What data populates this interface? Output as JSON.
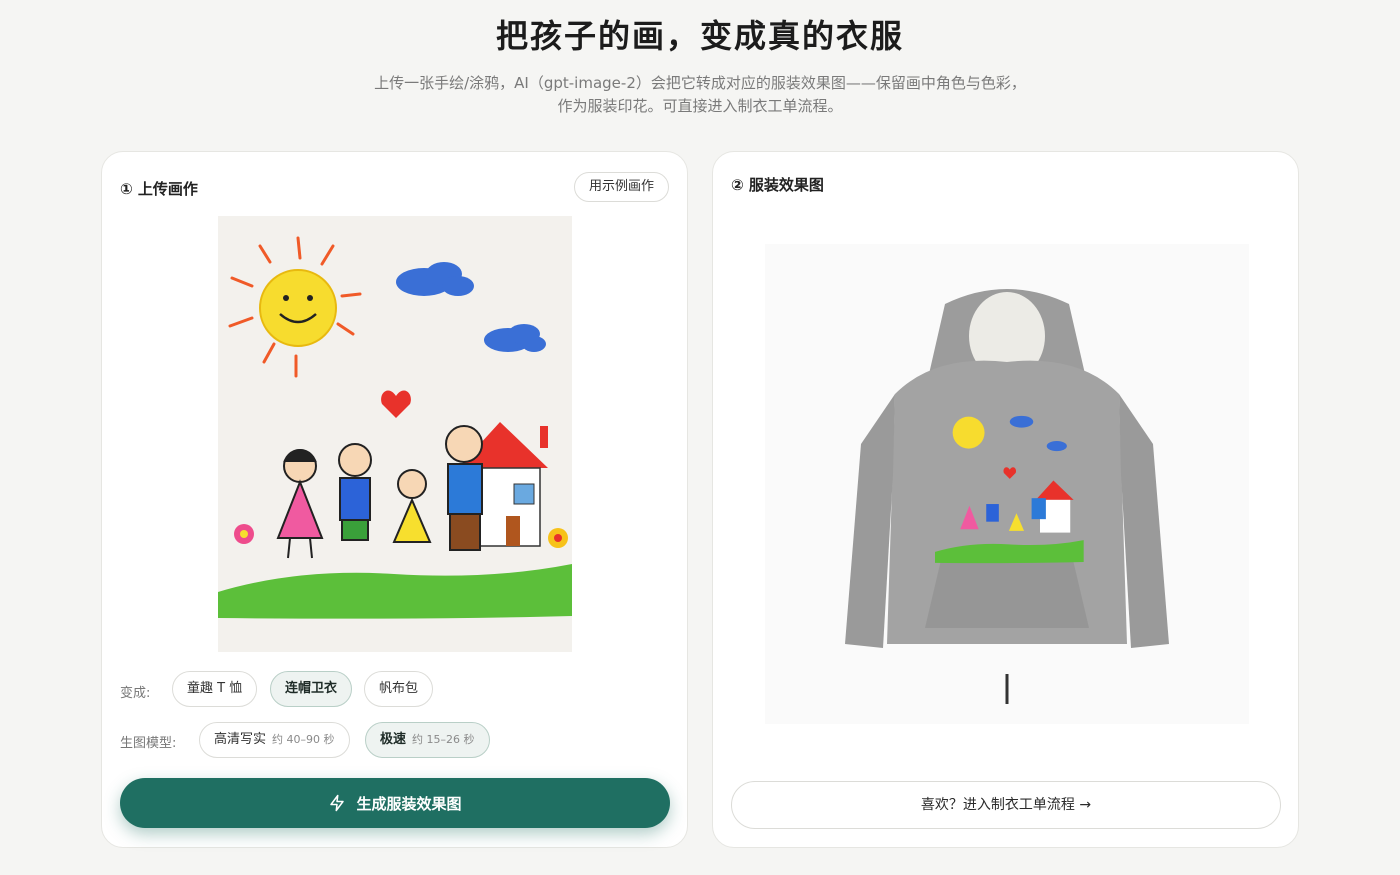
{
  "hero": {
    "title": "把孩子的画，变成真的衣服",
    "subtitle": "上传一张手绘/涂鸦，AI（gpt-image-2）会把它转成对应的服装效果图——保留画中角色与色彩，作为服装印花。可直接进入制衣工单流程。"
  },
  "upload": {
    "title": "① 上传画作",
    "sample_button": "用示例画作",
    "transform_label": "变成:",
    "garments": [
      {
        "label": "童趣 T 恤",
        "active": false
      },
      {
        "label": "连帽卫衣",
        "active": true
      },
      {
        "label": "帆布包",
        "active": false
      }
    ],
    "model_label": "生图模型:",
    "models": [
      {
        "label": "高清写实",
        "hint": "约 40–90 秒",
        "active": false
      },
      {
        "label": "极速",
        "hint": "约 15–26 秒",
        "active": true
      }
    ],
    "generate_button": "生成服装效果图"
  },
  "result": {
    "title": "② 服装效果图",
    "enter_button": "喜欢？进入制衣工单流程 →"
  },
  "icons": {
    "generate": "lightning-icon"
  },
  "colors": {
    "accent": "#1f6f62",
    "background": "#f5f5f3"
  }
}
